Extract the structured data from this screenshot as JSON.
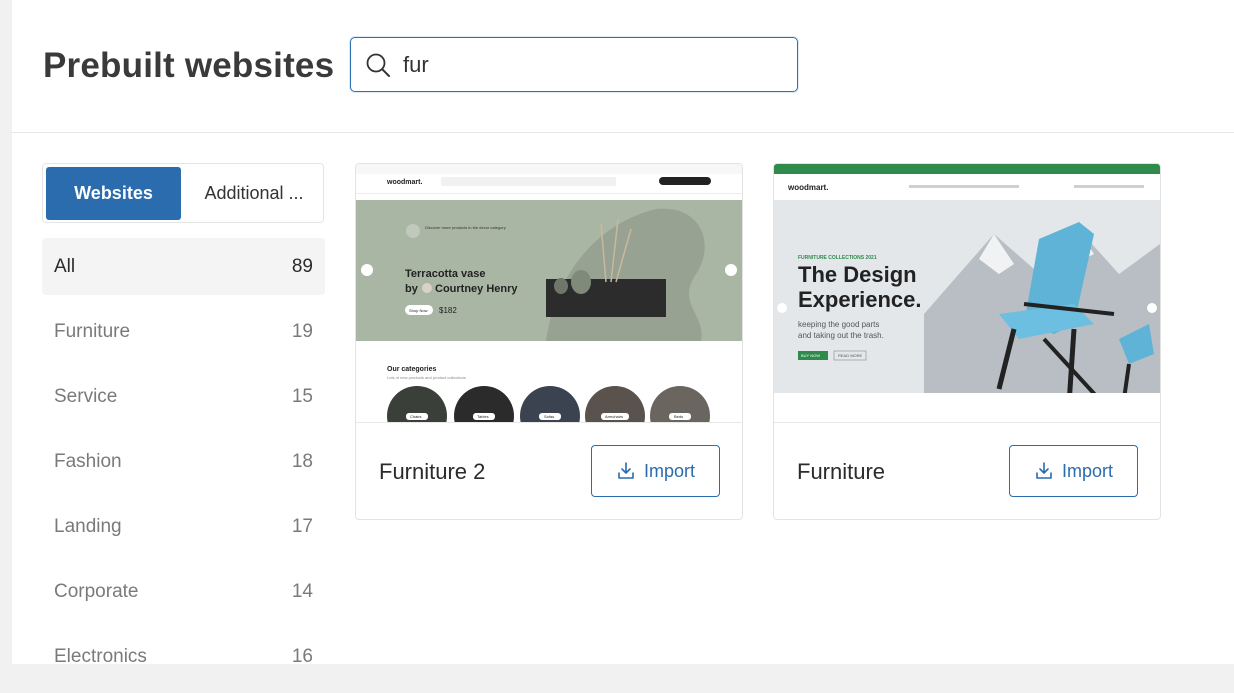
{
  "header": {
    "title": "Prebuilt websites",
    "search": {
      "value": "fur",
      "placeholder": ""
    }
  },
  "sidebar": {
    "tabs": [
      {
        "label": "Websites",
        "active": true
      },
      {
        "label": "Additional ..."
      }
    ],
    "categories": [
      {
        "label": "All",
        "count": "89",
        "active": true
      },
      {
        "label": "Furniture",
        "count": "19"
      },
      {
        "label": "Service",
        "count": "15"
      },
      {
        "label": "Fashion",
        "count": "18"
      },
      {
        "label": "Landing",
        "count": "17"
      },
      {
        "label": "Corporate",
        "count": "14"
      },
      {
        "label": "Electronics",
        "count": "16"
      }
    ]
  },
  "cards": [
    {
      "title": "Furniture 2",
      "import_label": "Import",
      "preview": {
        "logo": "woodmart.",
        "hero_title_1": "Terracotta vase",
        "hero_title_2": "by",
        "hero_author": "Courtney Henry",
        "hero_button": "Shop Now",
        "hero_price": "$182",
        "promo": "Discover more products in the decor category",
        "section_title": "Our categories",
        "section_sub": "Lots of new products and product collections",
        "categories": [
          "Chairs",
          "Tables",
          "Sofas",
          "Armchairs",
          "Beds"
        ]
      }
    },
    {
      "title": "Furniture",
      "import_label": "Import",
      "preview": {
        "logo": "woodmart.",
        "eyebrow": "FURNITURE COLLECTIONS 2021",
        "hero_title_1": "The Design",
        "hero_title_2": "Experience.",
        "hero_sub_1": "keeping the good parts",
        "hero_sub_2": "and taking out the trash.",
        "btn_primary": "BUY NOW",
        "btn_secondary": "READ MORE"
      }
    }
  ],
  "colors": {
    "accent": "#2a6cae",
    "preview_green": "#2e8b4c",
    "sage": "#aab6a4",
    "chair_blue": "#5fb3d6"
  }
}
